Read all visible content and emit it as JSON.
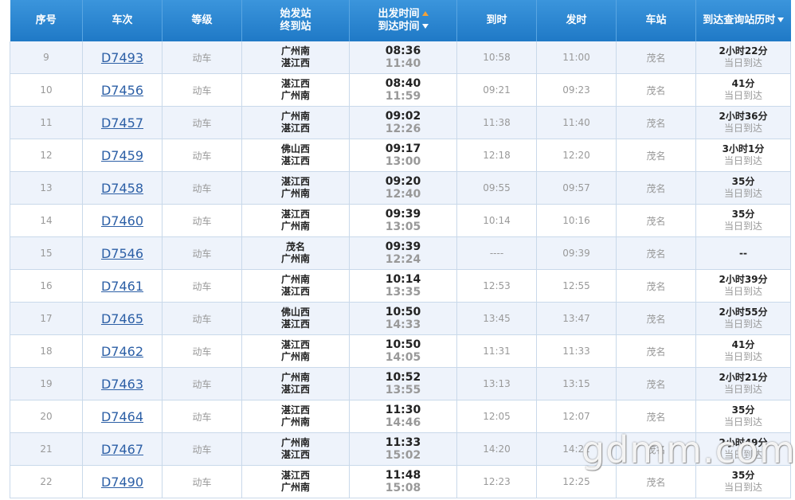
{
  "header": {
    "no": "序号",
    "train": "车次",
    "grade": "等级",
    "stations_top": "始发站",
    "stations_bottom": "终到站",
    "times_top": "出发时间",
    "times_bottom": "到达时间",
    "arrive": "到时",
    "depart": "发时",
    "station": "车站",
    "duration": "到达查询站历时"
  },
  "rows": [
    {
      "no": "9",
      "train": "D7493",
      "grade": "动车",
      "from": "广州南",
      "to": "湛江西",
      "dep": "08:36",
      "arr": "11:40",
      "arrive": "10:58",
      "depart": "11:00",
      "station": "茂名",
      "dur": "2小时22分",
      "day": "当日到达"
    },
    {
      "no": "10",
      "train": "D7456",
      "grade": "动车",
      "from": "湛江西",
      "to": "广州南",
      "dep": "08:40",
      "arr": "11:59",
      "arrive": "09:21",
      "depart": "09:23",
      "station": "茂名",
      "dur": "41分",
      "day": "当日到达"
    },
    {
      "no": "11",
      "train": "D7457",
      "grade": "动车",
      "from": "广州南",
      "to": "湛江西",
      "dep": "09:02",
      "arr": "12:26",
      "arrive": "11:38",
      "depart": "11:40",
      "station": "茂名",
      "dur": "2小时36分",
      "day": "当日到达"
    },
    {
      "no": "12",
      "train": "D7459",
      "grade": "动车",
      "from": "佛山西",
      "to": "湛江西",
      "dep": "09:17",
      "arr": "13:00",
      "arrive": "12:18",
      "depart": "12:20",
      "station": "茂名",
      "dur": "3小时1分",
      "day": "当日到达"
    },
    {
      "no": "13",
      "train": "D7458",
      "grade": "动车",
      "from": "湛江西",
      "to": "广州南",
      "dep": "09:20",
      "arr": "12:40",
      "arrive": "09:55",
      "depart": "09:57",
      "station": "茂名",
      "dur": "35分",
      "day": "当日到达"
    },
    {
      "no": "14",
      "train": "D7460",
      "grade": "动车",
      "from": "湛江西",
      "to": "广州南",
      "dep": "09:39",
      "arr": "13:05",
      "arrive": "10:14",
      "depart": "10:16",
      "station": "茂名",
      "dur": "35分",
      "day": "当日到达"
    },
    {
      "no": "15",
      "train": "D7546",
      "grade": "动车",
      "from": "茂名",
      "to": "广州南",
      "dep": "09:39",
      "arr": "12:24",
      "arrive": "----",
      "depart": "09:39",
      "station": "茂名",
      "dur": "--",
      "day": ""
    },
    {
      "no": "16",
      "train": "D7461",
      "grade": "动车",
      "from": "广州南",
      "to": "湛江西",
      "dep": "10:14",
      "arr": "13:35",
      "arrive": "12:53",
      "depart": "12:55",
      "station": "茂名",
      "dur": "2小时39分",
      "day": "当日到达"
    },
    {
      "no": "17",
      "train": "D7465",
      "grade": "动车",
      "from": "佛山西",
      "to": "湛江西",
      "dep": "10:50",
      "arr": "14:33",
      "arrive": "13:45",
      "depart": "13:47",
      "station": "茂名",
      "dur": "2小时55分",
      "day": "当日到达"
    },
    {
      "no": "18",
      "train": "D7462",
      "grade": "动车",
      "from": "湛江西",
      "to": "广州南",
      "dep": "10:50",
      "arr": "14:05",
      "arrive": "11:31",
      "depart": "11:33",
      "station": "茂名",
      "dur": "41分",
      "day": "当日到达"
    },
    {
      "no": "19",
      "train": "D7463",
      "grade": "动车",
      "from": "广州南",
      "to": "湛江西",
      "dep": "10:52",
      "arr": "13:55",
      "arrive": "13:13",
      "depart": "13:15",
      "station": "茂名",
      "dur": "2小时21分",
      "day": "当日到达"
    },
    {
      "no": "20",
      "train": "D7464",
      "grade": "动车",
      "from": "湛江西",
      "to": "广州南",
      "dep": "11:30",
      "arr": "14:46",
      "arrive": "12:05",
      "depart": "12:07",
      "station": "茂名",
      "dur": "35分",
      "day": "当日到达"
    },
    {
      "no": "21",
      "train": "D7467",
      "grade": "动车",
      "from": "广州南",
      "to": "湛江西",
      "dep": "11:33",
      "arr": "15:02",
      "arrive": "14:20",
      "depart": "14:22",
      "station": "茂名",
      "dur": "2小时49分",
      "day": "当日到达"
    },
    {
      "no": "22",
      "train": "D7490",
      "grade": "动车",
      "from": "湛江西",
      "to": "广州南",
      "dep": "11:48",
      "arr": "15:08",
      "arrive": "12:23",
      "depart": "12:25",
      "station": "茂名",
      "dur": "35分",
      "day": "当日到达"
    }
  ],
  "watermark": "gdmm.com"
}
